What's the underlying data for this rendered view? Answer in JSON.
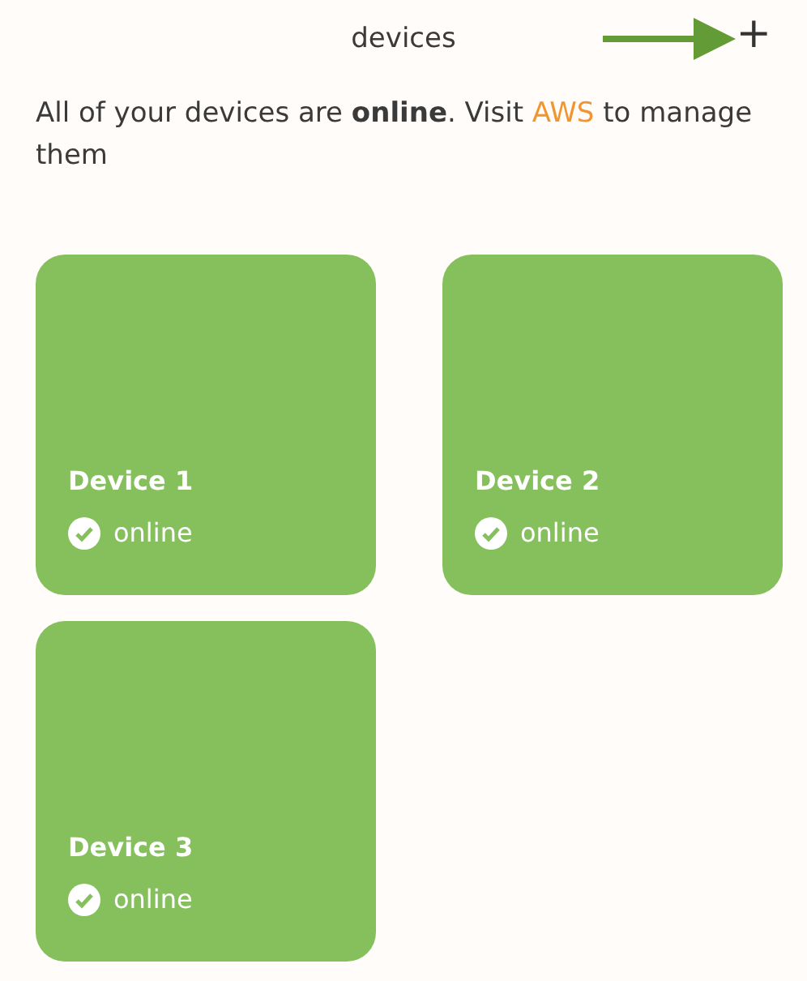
{
  "header": {
    "title": "devices",
    "add_button": "+"
  },
  "message": "All of your devices are **online**. Visit ",
  "link": "AWS",
  "message_end": " to manage them",
  "devices": [
    {
      "name": "Device 1",
      "status": "online",
      "online": true
    },
    {
      "name": "Device 2",
      "status": "online",
      "online": true
    },
    {
      "name": "Device 3",
      "status": "online",
      "online": true
    }
  ]
}
